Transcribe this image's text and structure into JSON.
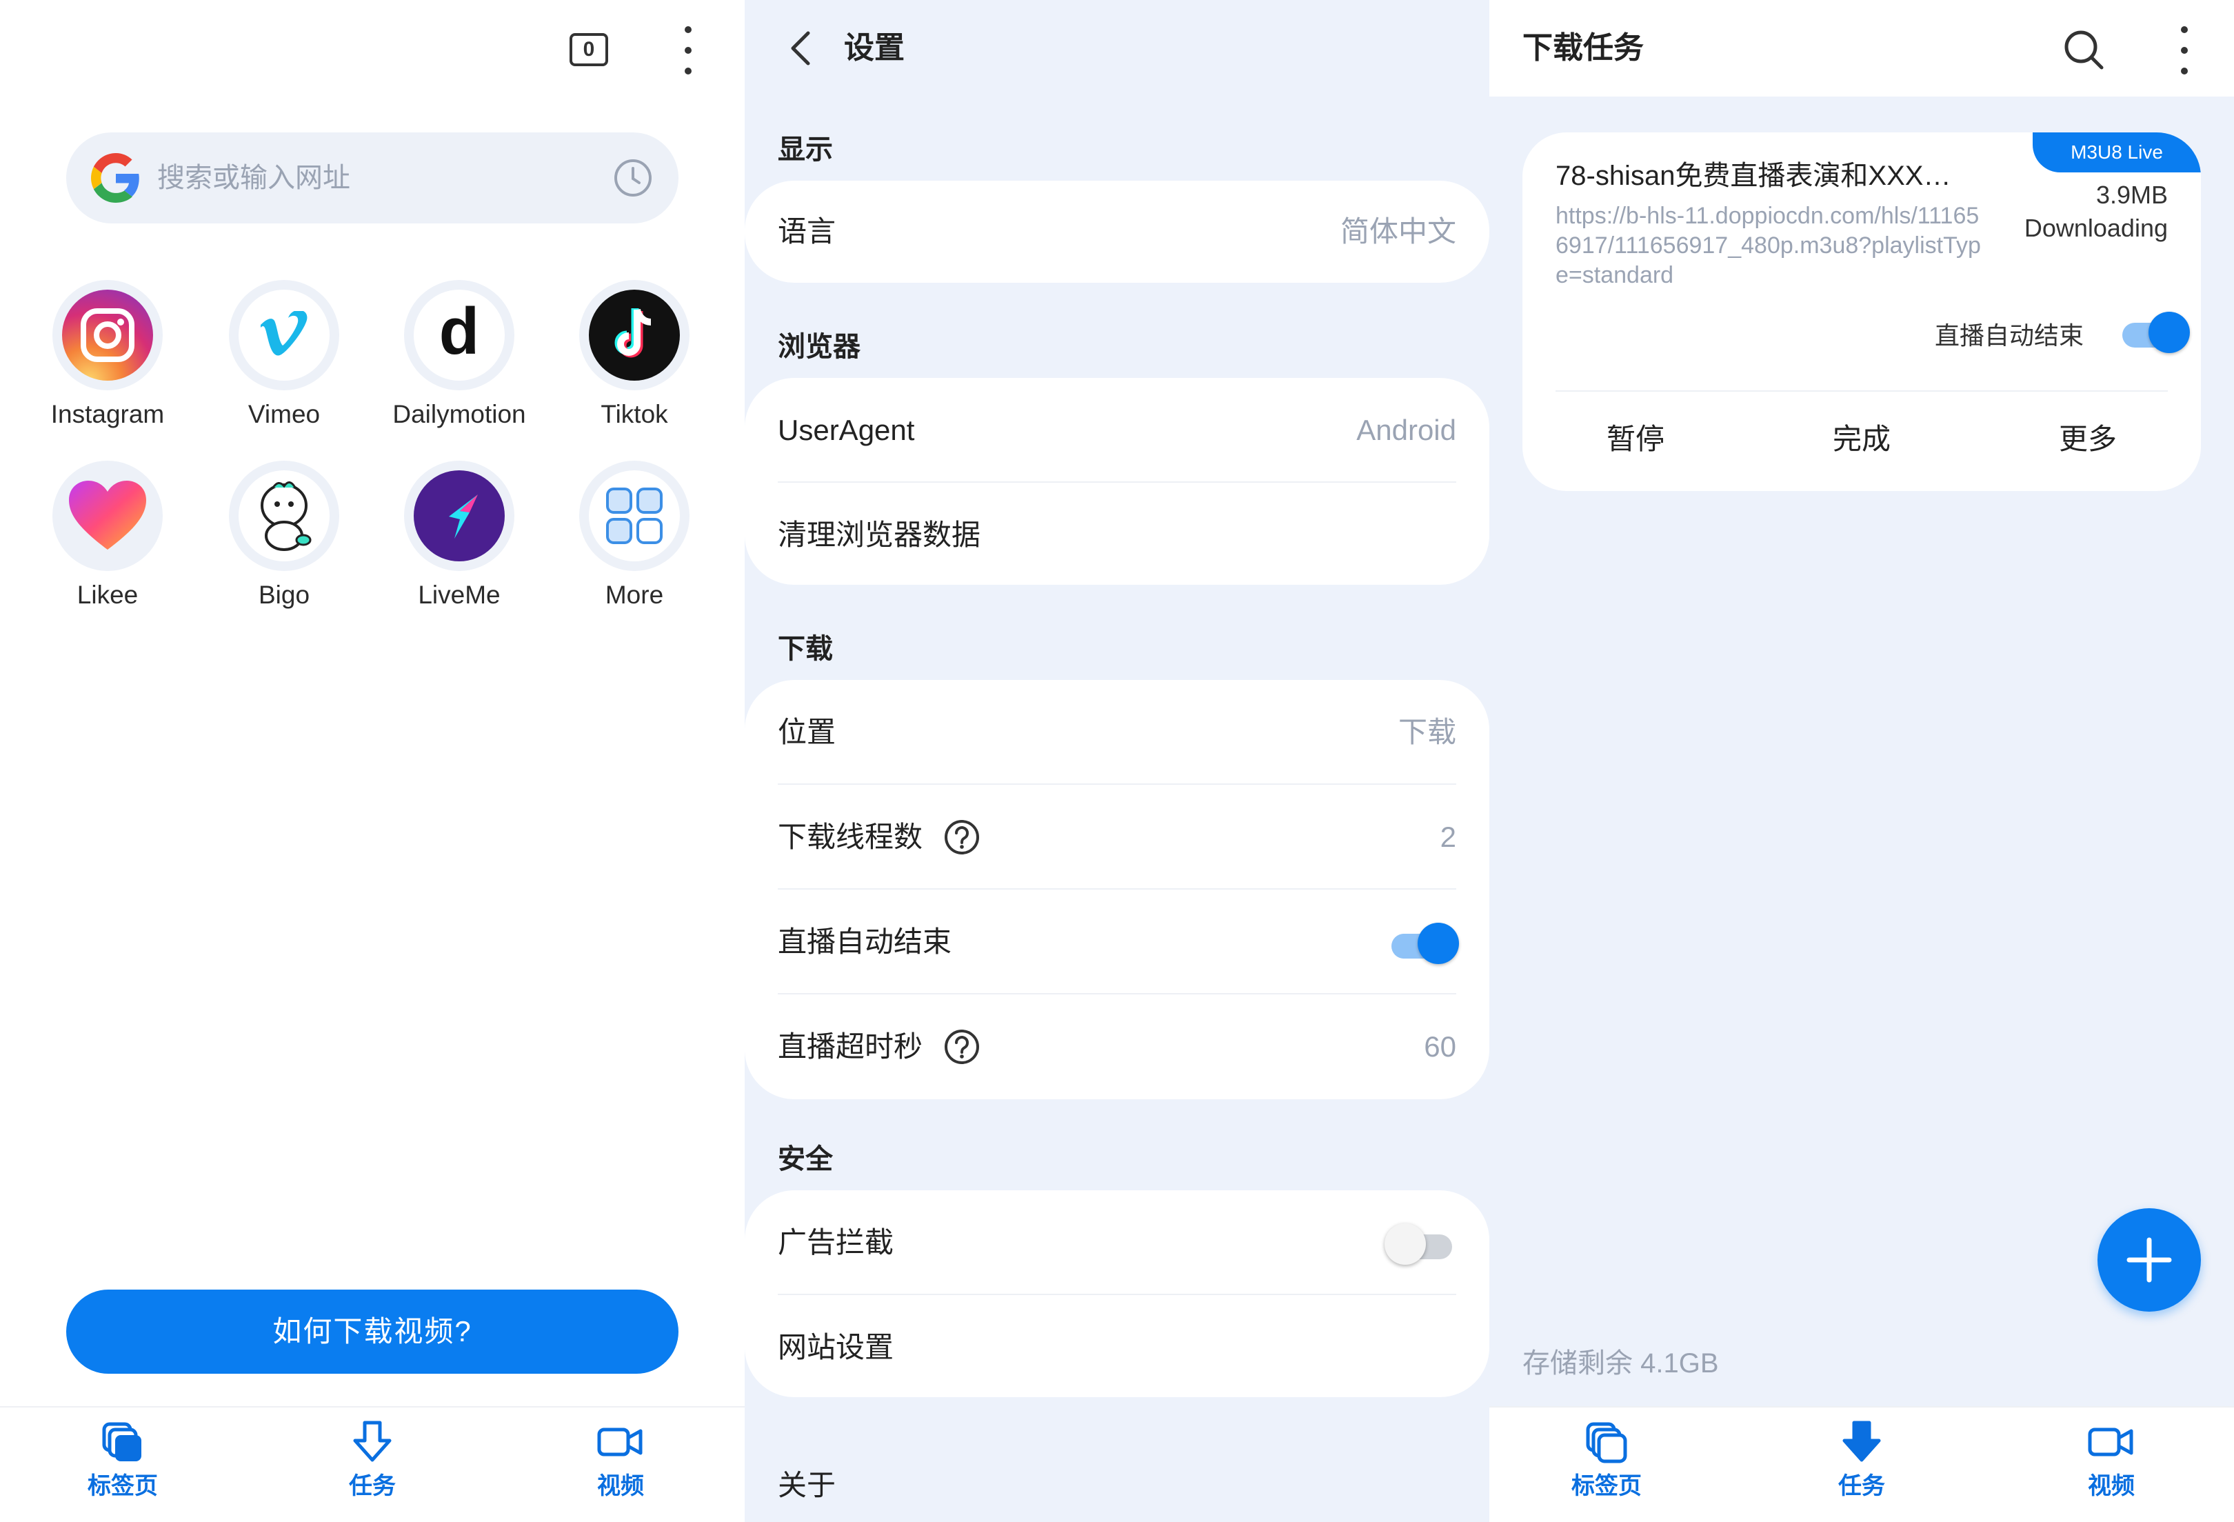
{
  "home": {
    "tab_count": "0",
    "search_placeholder": "搜索或输入网址",
    "apps": [
      {
        "label": "Instagram"
      },
      {
        "label": "Vimeo"
      },
      {
        "label": "Dailymotion"
      },
      {
        "label": "Tiktok"
      },
      {
        "label": "Likee"
      },
      {
        "label": "Bigo"
      },
      {
        "label": "LiveMe"
      },
      {
        "label": "More"
      }
    ],
    "how_button": "如何下载视频?",
    "nav": {
      "tabs": "标签页",
      "tasks": "任务",
      "videos": "视频"
    }
  },
  "settings": {
    "title": "设置",
    "sections": {
      "display": "显示",
      "browser": "浏览器",
      "download": "下载",
      "security": "安全"
    },
    "rows": {
      "language_label": "语言",
      "language_value": "简体中文",
      "useragent_label": "UserAgent",
      "useragent_value": "Android",
      "clear_data_label": "清理浏览器数据",
      "location_label": "位置",
      "location_value": "下载",
      "threads_label": "下载线程数",
      "threads_value": "2",
      "live_autoend_label": "直播自动结束",
      "live_timeout_label": "直播超时秒",
      "live_timeout_value": "60",
      "adblock_label": "广告拦截",
      "site_settings_label": "网站设置",
      "about_label": "关于"
    },
    "live_autoend_on": true,
    "adblock_on": false
  },
  "tasks": {
    "title": "下载任务",
    "item": {
      "badge": "M3U8 Live",
      "name": "78-shisan免费直播表演和XXX…",
      "url": "https://b-hls-11.doppiocdn.com/hls/111656917/111656917_480p.m3u8?playlistType=standard",
      "size": "3.9MB",
      "status": "Downloading",
      "autoend_label": "直播自动结束",
      "actions": {
        "pause": "暂停",
        "done": "完成",
        "more": "更多"
      }
    },
    "storage": "存储剩余 4.1GB",
    "nav": {
      "tabs": "标签页",
      "tasks": "任务",
      "videos": "视频"
    }
  },
  "colors": {
    "accent": "#0a7df0",
    "muted": "#9aa3b3",
    "panel_bg": "#edf2fb"
  }
}
